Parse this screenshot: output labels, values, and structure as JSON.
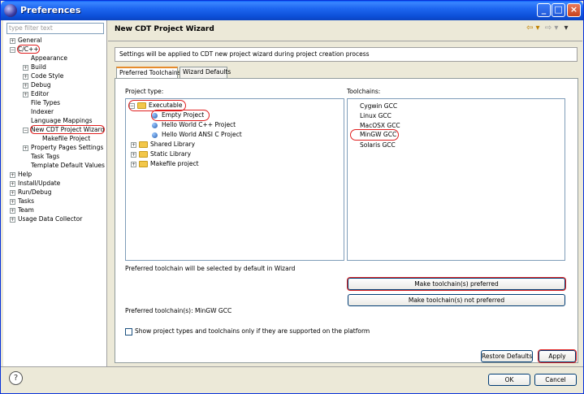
{
  "window": {
    "title": "Preferences"
  },
  "title_buttons": {
    "minimize": "_",
    "maximize": "□",
    "close": "×"
  },
  "filter": {
    "placeholder": "type filter text"
  },
  "tree": [
    {
      "label": "General",
      "expander": "+"
    },
    {
      "label": "C/C++",
      "expander": "−"
    },
    {
      "label": "Appearance",
      "expander": ""
    },
    {
      "label": "Build",
      "expander": "+"
    },
    {
      "label": "Code Style",
      "expander": "+"
    },
    {
      "label": "Debug",
      "expander": "+"
    },
    {
      "label": "Editor",
      "expander": "+"
    },
    {
      "label": "File Types",
      "expander": ""
    },
    {
      "label": "Indexer",
      "expander": ""
    },
    {
      "label": "Language Mappings",
      "expander": ""
    },
    {
      "label": "New CDT Project Wizard",
      "expander": "−"
    },
    {
      "label": "Makefile Project",
      "expander": ""
    },
    {
      "label": "Property Pages Settings",
      "expander": "+"
    },
    {
      "label": "Task Tags",
      "expander": ""
    },
    {
      "label": "Template Default Values",
      "expander": ""
    },
    {
      "label": "Help",
      "expander": "+"
    },
    {
      "label": "Install/Update",
      "expander": "+"
    },
    {
      "label": "Run/Debug",
      "expander": "+"
    },
    {
      "label": "Tasks",
      "expander": "+"
    },
    {
      "label": "Team",
      "expander": "+"
    },
    {
      "label": "Usage Data Collector",
      "expander": "+"
    }
  ],
  "main": {
    "title": "New CDT Project Wizard",
    "nav": {
      "back": "⇦ ▾",
      "forward": "⇨ ▾",
      "menu": "▾"
    },
    "description": "Settings will be applied to CDT new project wizard during project creation process",
    "tabs": [
      "Preferred Toolchains",
      "Wizard Defaults"
    ],
    "project_type_label": "Project type:",
    "toolchains_label": "Toolchains:",
    "project_types": [
      {
        "label": "Executable",
        "expander": "−"
      },
      {
        "label": "Empty Project",
        "expander": ""
      },
      {
        "label": "Hello World C++ Project",
        "expander": ""
      },
      {
        "label": "Hello World ANSI C Project",
        "expander": ""
      },
      {
        "label": "Shared Library",
        "expander": "+"
      },
      {
        "label": "Static Library",
        "expander": "+"
      },
      {
        "label": "Makefile project",
        "expander": "+"
      }
    ],
    "toolchains": [
      "Cygwin GCC",
      "Linux GCC",
      "MacOSX GCC",
      "MinGW GCC",
      "Solaris GCC"
    ],
    "preferred_note": "Preferred toolchain will be selected by default in Wizard",
    "make_preferred_button": "Make toolchain(s) preferred",
    "make_not_preferred_button": "Make toolchain(s) not preferred",
    "preferred_toolchains": "Preferred toolchain(s): MinGW GCC",
    "supported_only_checkbox": "Show project types and toolchains only if they are supported on the platform",
    "restore_defaults_button": "Restore Defaults",
    "apply_button": "Apply"
  },
  "footer": {
    "help": "?",
    "ok": "OK",
    "cancel": "Cancel"
  }
}
